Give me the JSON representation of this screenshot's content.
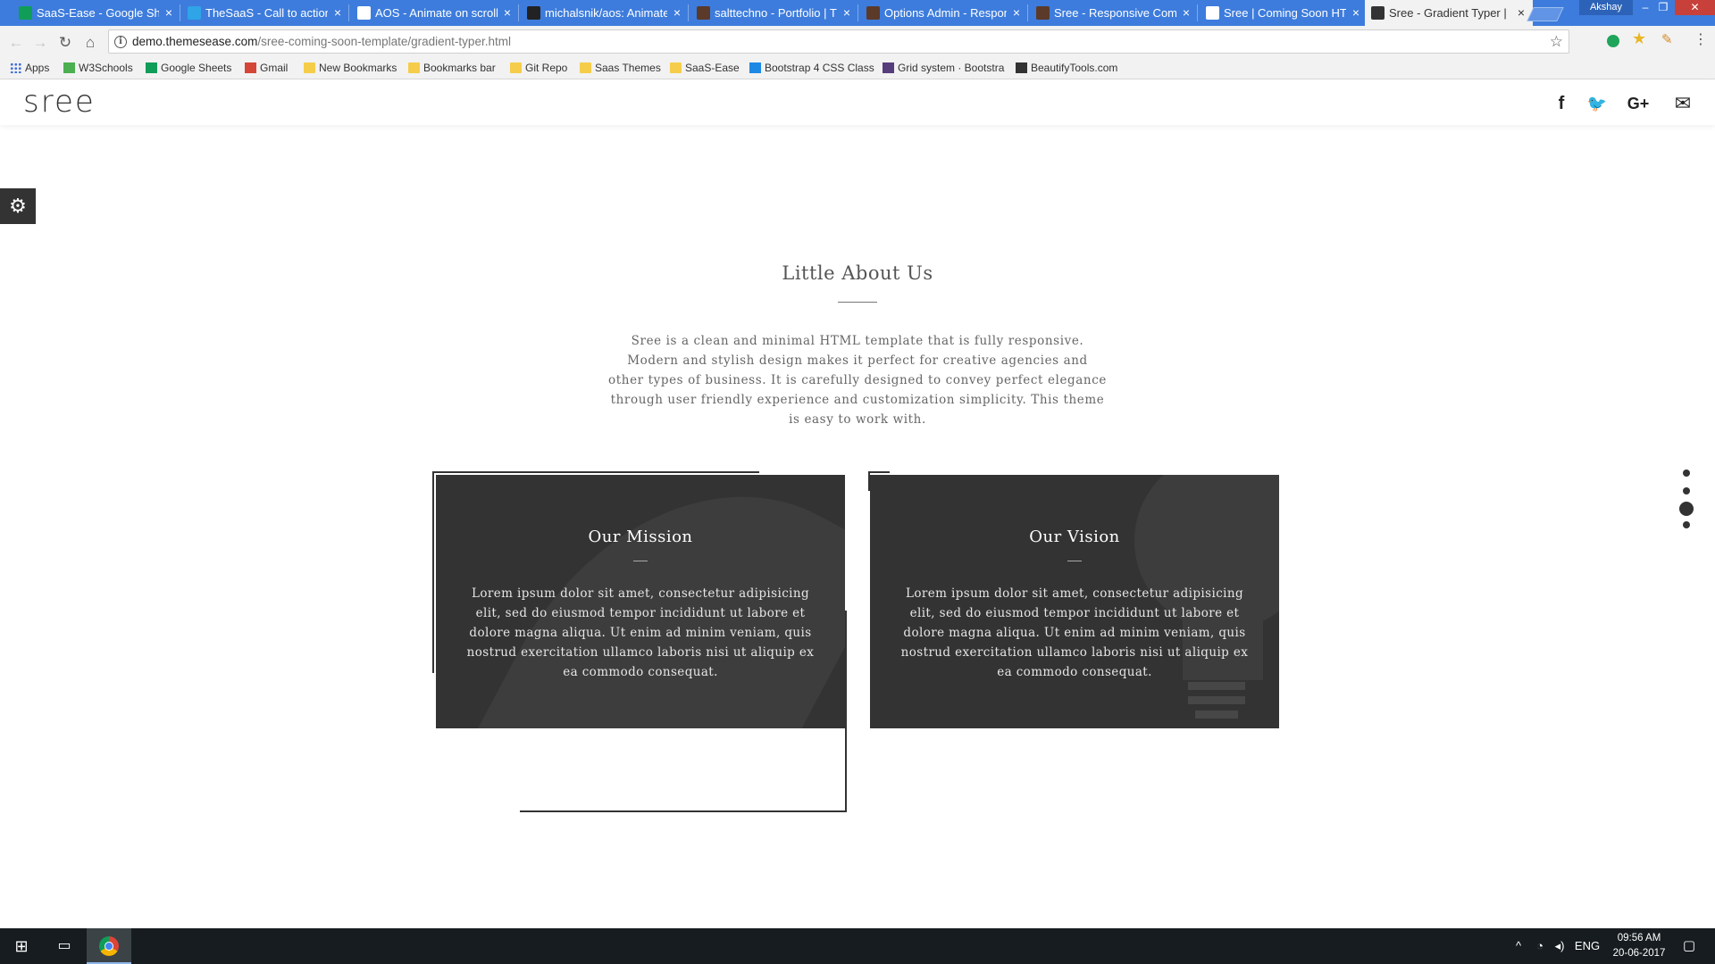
{
  "browser": {
    "tabs": [
      {
        "title": "SaaS-Ease - Google Sheets",
        "icon": "sheets-icon",
        "color": "#0f9d58",
        "active": false
      },
      {
        "title": "TheSaaS - Call to action",
        "icon": "thesaas-icon",
        "color": "#2fa4e7",
        "active": false
      },
      {
        "title": "AOS - Animate on scroll",
        "icon": "document-icon",
        "color": "#ffffff",
        "active": false
      },
      {
        "title": "michalsnik/aos: Animate",
        "icon": "github-icon",
        "color": "#222222",
        "active": false
      },
      {
        "title": "salttechno - Portfolio | T",
        "icon": "thumbnail-icon",
        "color": "#5b3a29",
        "active": false
      },
      {
        "title": "Options Admin - Respon",
        "icon": "thumbnail-icon",
        "color": "#5b3a29",
        "active": false
      },
      {
        "title": "Sree - Responsive Comi",
        "icon": "thumbnail-icon",
        "color": "#5b3a29",
        "active": false
      },
      {
        "title": "Sree | Coming Soon HT",
        "icon": "paper-plane-icon",
        "color": "#ffffff",
        "active": false
      },
      {
        "title": "Sree - Gradient Typer |",
        "icon": "paper-plane-icon",
        "color": "#333333",
        "active": true
      }
    ],
    "close_glyph": "×",
    "profile_name": "Akshay",
    "window_controls": {
      "minimize": "–",
      "maximize": "❐",
      "close": "✕"
    },
    "url_host": "demo.themesease.com",
    "url_path": "/sree-coming-soon-template/gradient-typer.html",
    "nav": {
      "back": "←",
      "forward": "→",
      "reload": "↻",
      "home": "⌂"
    },
    "bookmarks": [
      {
        "label": "Apps",
        "icon": "apps-icon"
      },
      {
        "label": "W3Schools",
        "icon": "w3schools-icon"
      },
      {
        "label": "Google Sheets",
        "icon": "sheets-icon"
      },
      {
        "label": "Gmail",
        "icon": "gmail-icon"
      },
      {
        "label": "New Bookmarks",
        "icon": "folder-icon"
      },
      {
        "label": "Bookmarks bar",
        "icon": "folder-icon"
      },
      {
        "label": "Git Repo",
        "icon": "folder-icon"
      },
      {
        "label": "Saas Themes",
        "icon": "folder-icon"
      },
      {
        "label": "SaaS-Ease",
        "icon": "folder-icon"
      },
      {
        "label": "Bootstrap 4 CSS Class",
        "icon": "bootstrap-icon"
      },
      {
        "label": "Grid system · Bootstra",
        "icon": "bootstrap-b-icon"
      },
      {
        "label": "BeautifyTools.com",
        "icon": "beautifytools-icon"
      }
    ]
  },
  "site": {
    "logo": "sree",
    "social": [
      {
        "name": "facebook-icon",
        "glyph": "f"
      },
      {
        "name": "twitter-icon",
        "glyph": "🐦"
      },
      {
        "name": "google-plus-icon",
        "glyph": "G+"
      },
      {
        "name": "email-icon",
        "glyph": "✉"
      }
    ],
    "settings_glyph": "⚙",
    "about": {
      "title": "Little About Us",
      "text": "Sree is a clean and minimal HTML template that is fully responsive. Modern and stylish design makes it perfect for creative agencies and other types of business. It is carefully designed to convey perfect elegance through user friendly experience and customization simplicity. This theme is easy to work with."
    },
    "cards": [
      {
        "title": "Our Mission",
        "text": "Lorem ipsum dolor sit amet, consectetur adipisicing elit, sed do eiusmod tempor incididunt ut labore et dolore magna aliqua. Ut enim ad minim veniam, quis nostrud exercitation ullamco laboris nisi ut aliquip ex ea commodo consequat."
      },
      {
        "title": "Our Vision",
        "text": "Lorem ipsum dolor sit amet, consectetur adipisicing elit, sed do eiusmod tempor incididunt ut labore et dolore magna aliqua. Ut enim ad minim veniam, quis nostrud exercitation ullamco laboris nisi ut aliquip ex ea commodo consequat."
      }
    ],
    "section_dots": {
      "count": 4,
      "active": 2
    }
  },
  "taskbar": {
    "language": "ENG",
    "time": "09:56 AM",
    "date": "20-06-2017"
  }
}
